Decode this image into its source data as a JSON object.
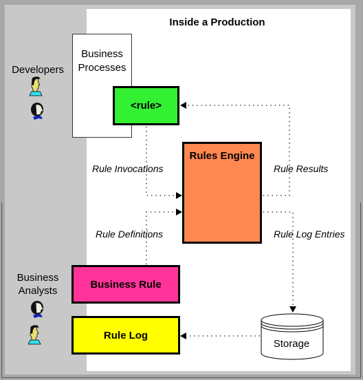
{
  "title": "Inside a Production",
  "roles": {
    "developers": "Developers",
    "analysts_line1": "Business",
    "analysts_line2": "Analysts"
  },
  "business_processes": {
    "line1": "Business",
    "line2": "Processes"
  },
  "nodes": {
    "rule": "<rule>",
    "engine": "Rules Engine",
    "business_rule": "Business Rule",
    "rule_log": "Rule Log",
    "storage": "Storage"
  },
  "flows": {
    "invocations": "Rule Invocations",
    "results": "Rule Results",
    "definitions": "Rule Definitions",
    "log_entries": "Rule Log Entries"
  },
  "colors": {
    "rule": "#33f033",
    "engine": "#ff8850",
    "business_rule": "#ff3399",
    "rule_log": "#ffff00",
    "background_gray": "#c8c8c8",
    "frame_gray": "#a8a8a8"
  },
  "icons": {
    "developer_1": "man-person-icon",
    "developer_2": "woman-person-icon",
    "analyst_1": "woman-person-icon",
    "analyst_2": "man-person-icon"
  }
}
